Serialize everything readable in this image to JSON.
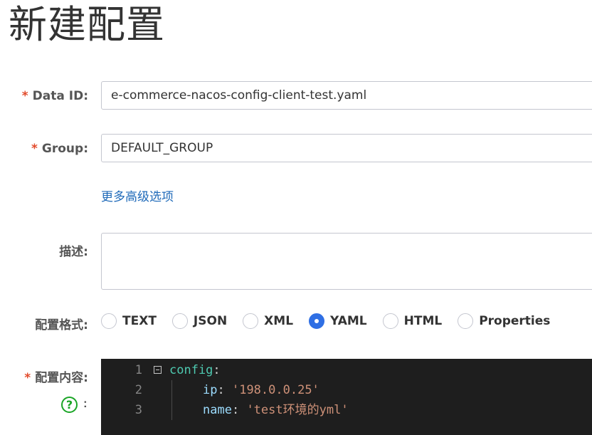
{
  "page": {
    "title": "新建配置"
  },
  "form": {
    "data_id": {
      "label": "Data ID:",
      "value": "e-commerce-nacos-config-client-test.yaml"
    },
    "group": {
      "label": "Group:",
      "value": "DEFAULT_GROUP"
    },
    "advanced_link": "更多高级选项",
    "description": {
      "label": "描述:",
      "value": ""
    },
    "format": {
      "label": "配置格式:",
      "options": [
        "TEXT",
        "JSON",
        "XML",
        "YAML",
        "HTML",
        "Properties"
      ],
      "selected": "YAML"
    },
    "content": {
      "label": "配置内容:",
      "help_colon": ":",
      "lines": [
        {
          "num": "1",
          "key": "config",
          "colon": ":"
        },
        {
          "num": "2",
          "key": "ip",
          "colon": ": ",
          "value": "'198.0.0.25'"
        },
        {
          "num": "3",
          "key": "name",
          "colon": ": ",
          "value": "'test环境的yml'"
        }
      ]
    },
    "required_mark": "*",
    "help_mark": "?"
  },
  "colors": {
    "required": "#e24a2a",
    "link": "#1f6ab9",
    "radio_selected": "#2f6fe4",
    "editor_bg": "#1e1e1e",
    "help_icon": "#1aa526"
  }
}
